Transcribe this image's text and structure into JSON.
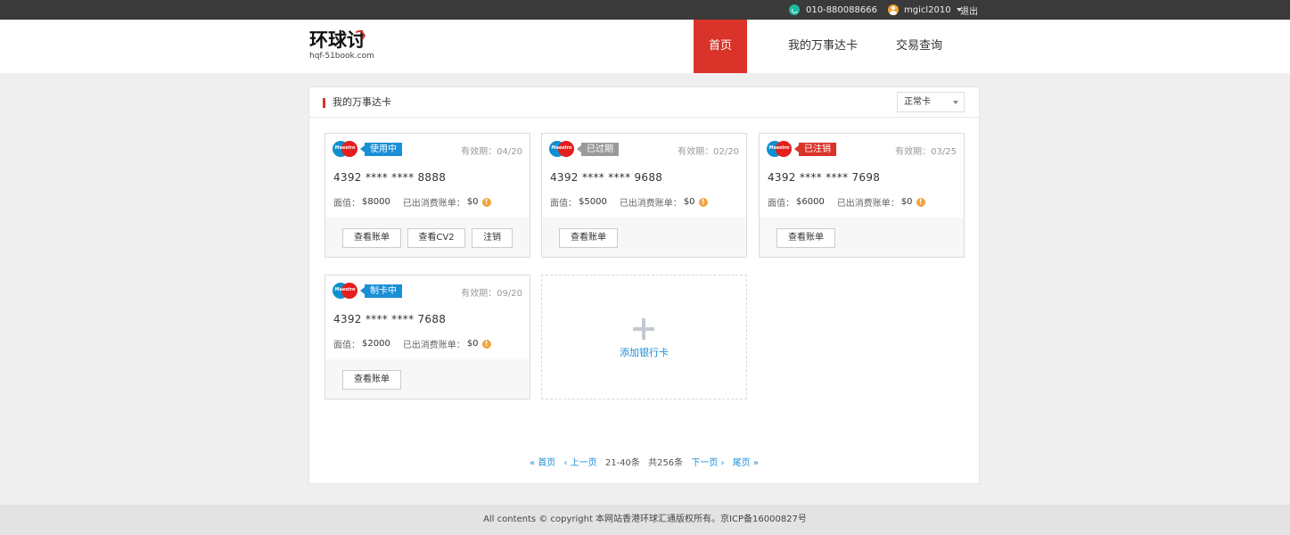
{
  "topbar": {
    "phone": "010-880088666",
    "username": "mgicl2010",
    "logout": "退出"
  },
  "header": {
    "logo_cn": "环球讨",
    "logo_en": "hqf-51book.com",
    "nav": [
      "首页",
      "我的万事达卡",
      "交易查询"
    ],
    "active_nav": "首页"
  },
  "panel": {
    "title": "我的万事达卡",
    "filter": {
      "selected": "正常卡"
    }
  },
  "cards": [
    {
      "brand": "Maestro",
      "status": "使用中",
      "status_color": "#1a8fd6",
      "expiry": "有效期：04/20",
      "number": "4392 **** **** 8888",
      "face_label": "面值：",
      "face_value": "$8000",
      "billed_label": "已出消费账单：",
      "billed_value": "$0",
      "buttons": [
        "查看账单",
        "查看CV2",
        "注销"
      ]
    },
    {
      "brand": "Maestro",
      "status": "已过期",
      "status_color": "#9a9a9a",
      "expiry": "有效期：02/20",
      "number": "4392 **** **** 9688",
      "face_label": "面值：",
      "face_value": "$5000",
      "billed_label": "已出消费账单：",
      "billed_value": "$0",
      "buttons": [
        "查看账单"
      ]
    },
    {
      "brand": "Maestro",
      "status": "已注销",
      "status_color": "#d9332a",
      "expiry": "有效期：03/25",
      "number": "4392 **** **** 7698",
      "face_label": "面值：",
      "face_value": "$6000",
      "billed_label": "已出消费账单：",
      "billed_value": "$0",
      "buttons": [
        "查看账单"
      ]
    },
    {
      "brand": "Maestro",
      "status": "制卡中",
      "status_color": "#1a8fd6",
      "expiry": "有效期：09/20",
      "number": "4392 **** **** 7688",
      "face_label": "面值：",
      "face_value": "$2000",
      "billed_label": "已出消费账单：",
      "billed_value": "$0",
      "buttons": [
        "查看账单"
      ]
    }
  ],
  "add_card": {
    "label": "添加银行卡",
    "icon": "plus-icon"
  },
  "pager": {
    "first": "首页",
    "prev": "上一页",
    "range": "21-40条",
    "total": "共256条",
    "next": "下一页",
    "last": "尾页"
  },
  "footer": {
    "text": "All contents © copyright 本网站香港环球汇通版权所有。京ICP备16000827号"
  }
}
